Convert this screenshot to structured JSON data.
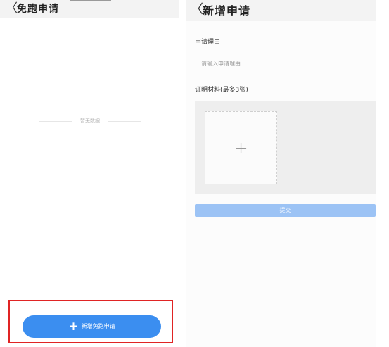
{
  "left_screen": {
    "title": "免跑申请",
    "back_glyph": "〈",
    "empty_text": "暂无数据",
    "add_button": {
      "icon": "plus-icon",
      "plus_glyph": "+",
      "label": "新增免跑申请"
    },
    "colors": {
      "accent": "#3b8ef0",
      "highlight": "#e02424"
    }
  },
  "right_screen": {
    "title": "新增申请",
    "back_glyph": "〈",
    "reason": {
      "label": "申请理由",
      "placeholder": "请输入申请理由",
      "value": ""
    },
    "materials": {
      "label": "证明材料(最多3张)",
      "upload_glyph": "+"
    },
    "submit_label": "提交",
    "colors": {
      "submit": "#9cc3f5"
    }
  }
}
